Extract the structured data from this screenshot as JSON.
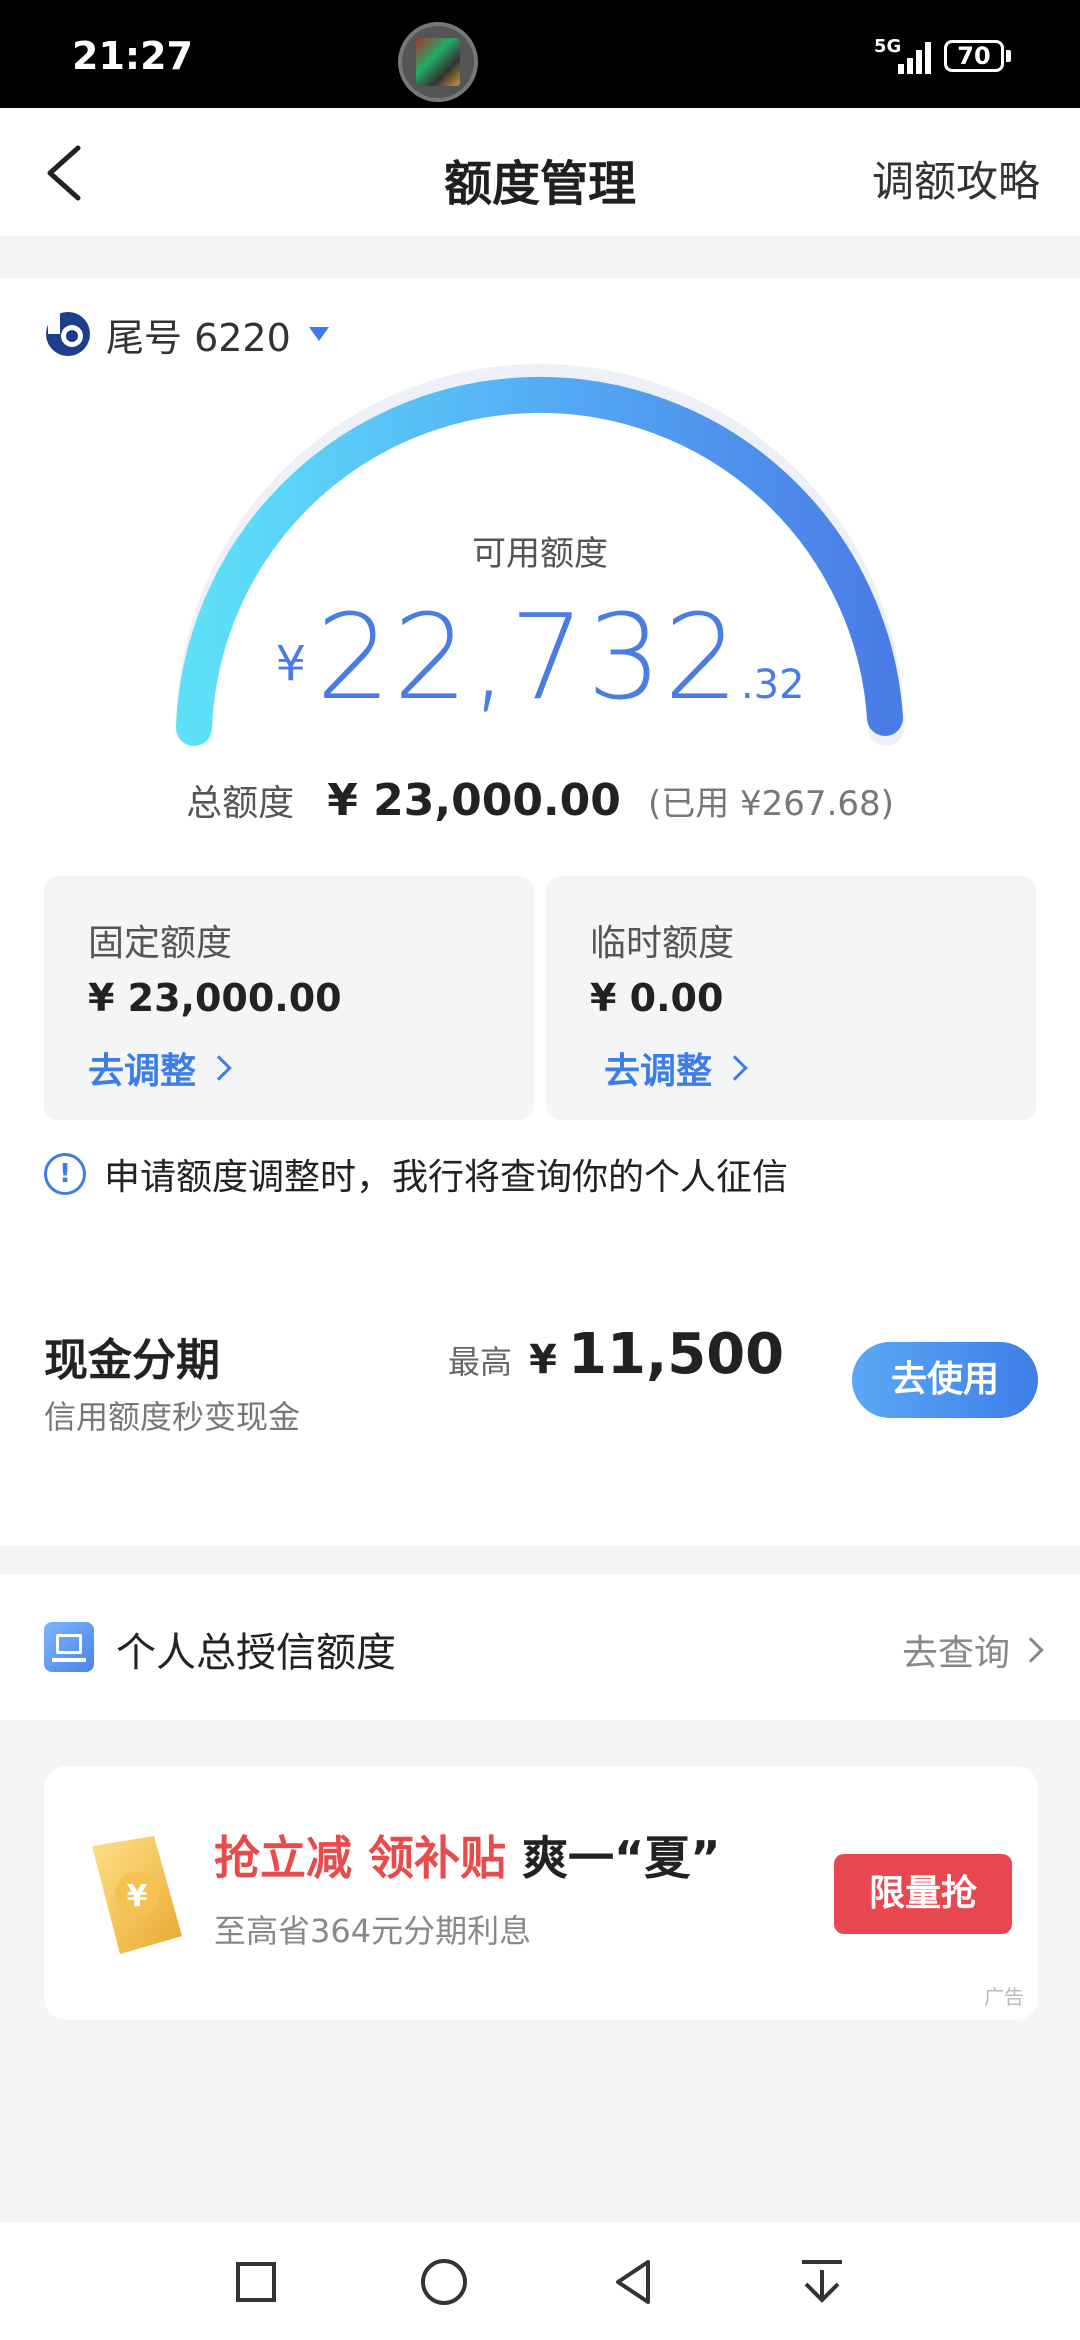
{
  "status_bar": {
    "time": "21:27",
    "network": "5G",
    "battery": "70"
  },
  "header": {
    "title": "额度管理",
    "link": "调额攻略"
  },
  "card": {
    "label": "尾号 6220"
  },
  "available": {
    "label": "可用额度",
    "currency": "¥",
    "integer": "22,732",
    "decimal": ".32"
  },
  "total": {
    "label": "总额度",
    "value": "¥ 23,000.00",
    "used": "(已用 ¥267.68)"
  },
  "quotas": {
    "fixed": {
      "title": "固定额度",
      "value": "¥ 23,000.00",
      "action": "去调整"
    },
    "temporary": {
      "title": "临时额度",
      "value": "¥ 0.00",
      "action": "去调整"
    }
  },
  "notice": {
    "icon": "!",
    "text": "申请额度调整时，我行将查询你的个人征信"
  },
  "cash_installment": {
    "title": "现金分期",
    "subtitle": "信用额度秒变现金",
    "max_label": "最高",
    "currency": "¥",
    "max_value": "11,500",
    "button": "去使用"
  },
  "credit": {
    "title": "个人总授信额度",
    "link": "去查询"
  },
  "promo": {
    "title_red": "抢立减 领补贴",
    "title_dark": "爽一“夏”",
    "subtitle": "至高省364元分期利息",
    "button": "限量抢",
    "ad": "广告"
  },
  "colors": {
    "accent": "#3d7de8",
    "red": "#e84b4b"
  }
}
